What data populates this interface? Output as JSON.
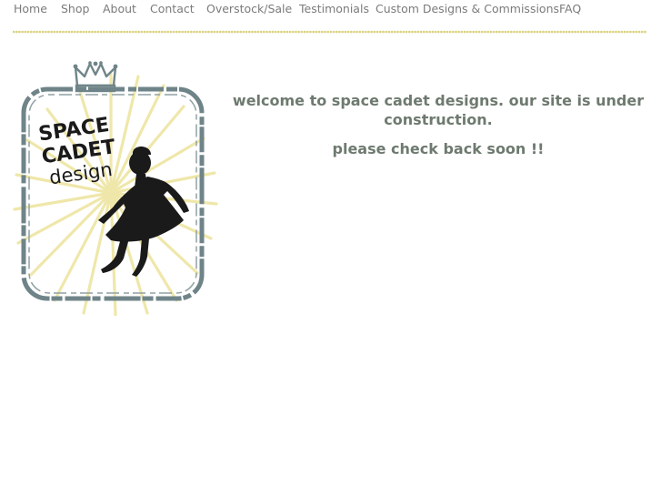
{
  "nav": {
    "items": [
      {
        "label": "Home"
      },
      {
        "label": "Shop"
      },
      {
        "label": "About"
      },
      {
        "label": "Contact"
      },
      {
        "label": "Overstock/Sale"
      },
      {
        "label": "Testimonials"
      },
      {
        "label": "Custom Designs & Commissions"
      },
      {
        "label": "FAQ"
      }
    ]
  },
  "logo": {
    "line1": "SPACE",
    "line2": "CADET",
    "line3": "design",
    "icons": [
      "crown-icon",
      "girl-silhouette-icon"
    ]
  },
  "main": {
    "welcome_text": "welcome to space cadet designs.  our site is under construction.",
    "check_back_text": "please check back soon !!"
  },
  "colors": {
    "nav_text": "#7b7b7b",
    "dotted_rule": "#d9d27c",
    "headline": "#6e7a6f",
    "frame": "#6f8488",
    "sunburst": "#efe6a6",
    "silhouette": "#1a1a1a"
  }
}
